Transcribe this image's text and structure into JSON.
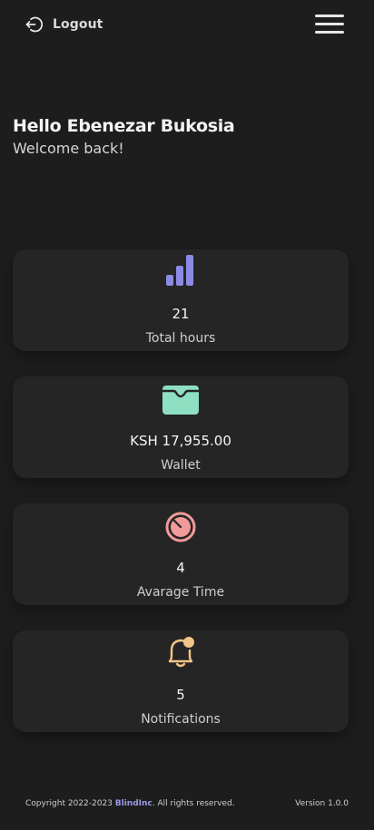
{
  "header": {
    "logout_label": "Logout",
    "logout_icon": "logout-icon",
    "menu_icon": "hamburger-menu-icon"
  },
  "greeting": {
    "hello": "Hello Ebenezar Bukosia",
    "welcome": "Welcome back!"
  },
  "cards": [
    {
      "icon": "bar-chart-icon",
      "value": "21",
      "label": "Total hours",
      "color": "#8b8be6"
    },
    {
      "icon": "wallet-icon",
      "value": "KSH 17,955.00",
      "label": "Wallet",
      "color": "#8fe0c2"
    },
    {
      "icon": "timer-icon",
      "value": "4",
      "label": "Avarage Time",
      "color": "#f19a9a"
    },
    {
      "icon": "bell-notification-icon",
      "value": "5",
      "label": "Notifications",
      "color": "#f2c58a"
    }
  ],
  "footer": {
    "copyright_prefix": "Copyright 2022-2023",
    "brand": "BlindInc",
    "copyright_suffix": ". All rights reserved.",
    "version": "Version 1.0.0"
  },
  "colors": {
    "background": "#1d1d1d",
    "card": "#252525",
    "brand": "#9a9ae8"
  }
}
